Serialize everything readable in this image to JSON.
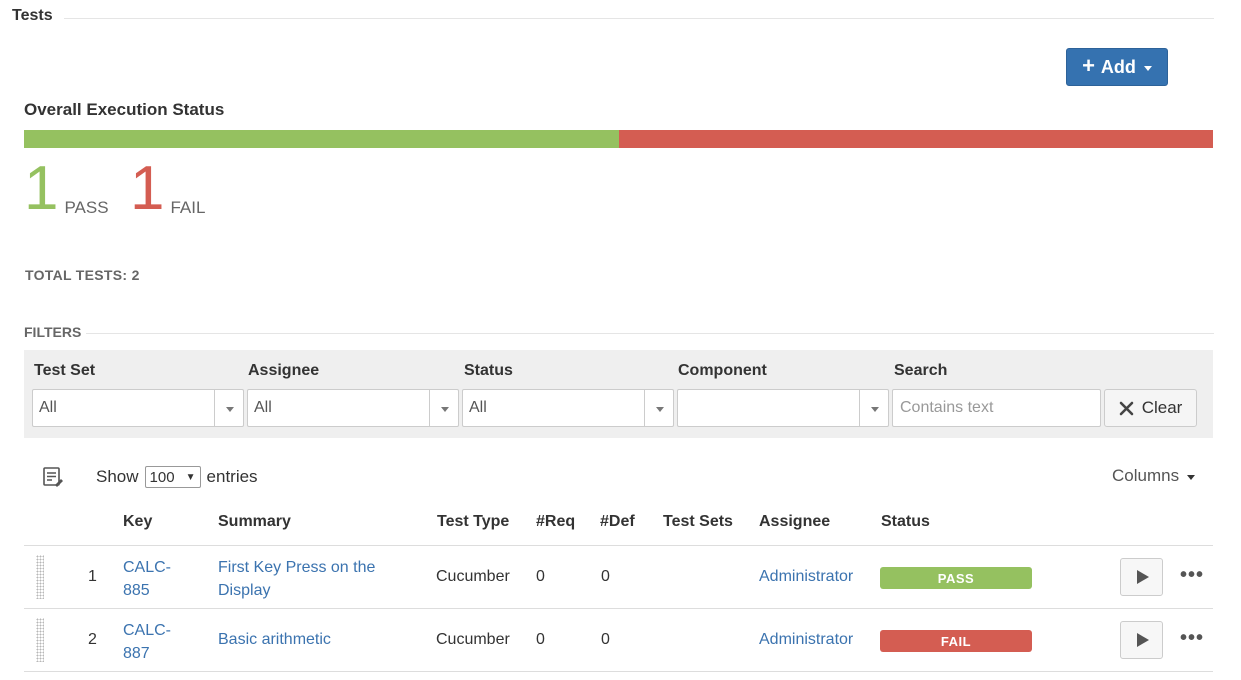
{
  "section": {
    "title": "Tests"
  },
  "add_button": {
    "plus": "+",
    "label": "Add"
  },
  "overall": {
    "title": "Overall Execution Status",
    "pass_fraction": 0.5,
    "fail_fraction": 0.5,
    "pass_count": "1",
    "pass_label": "PASS",
    "fail_count": "1",
    "fail_label": "FAIL",
    "total_label": "TOTAL TESTS: 2"
  },
  "colors": {
    "pass": "#95c160",
    "fail": "#d45d52",
    "link": "#3b73af",
    "primary": "#3572b0"
  },
  "filters": {
    "title": "FILTERS",
    "test_set": {
      "label": "Test Set",
      "value": "All"
    },
    "assignee": {
      "label": "Assignee",
      "value": "All"
    },
    "status": {
      "label": "Status",
      "value": "All"
    },
    "component": {
      "label": "Component",
      "value": ""
    },
    "search": {
      "label": "Search",
      "placeholder": "Contains text",
      "value": ""
    },
    "clear_label": "Clear"
  },
  "entries": {
    "show": "Show",
    "value": "100",
    "suffix": "entries",
    "columns": "Columns"
  },
  "table": {
    "headers": {
      "key": "Key",
      "summary": "Summary",
      "test_type": "Test Type",
      "req": "#Req",
      "def": "#Def",
      "test_sets": "Test Sets",
      "assignee": "Assignee",
      "status": "Status"
    },
    "rows": [
      {
        "index": "1",
        "key_line1": "CALC-",
        "key_line2": "885",
        "summary_line1": "First Key Press on the",
        "summary_line2": "Display",
        "test_type": "Cucumber",
        "req": "0",
        "def": "0",
        "test_sets": "",
        "assignee": "Administrator",
        "status": "PASS"
      },
      {
        "index": "2",
        "key_line1": "CALC-",
        "key_line2": "887",
        "summary_line1": "Basic arithmetic",
        "summary_line2": "",
        "test_type": "Cucumber",
        "req": "0",
        "def": "0",
        "test_sets": "",
        "assignee": "Administrator",
        "status": "FAIL"
      }
    ]
  },
  "icons": {
    "add": "plus-icon",
    "clear": "x-icon",
    "list": "list-edit-icon",
    "run": "play-icon",
    "more": "ellipsis-icon",
    "dropdown": "caret-down-icon"
  }
}
